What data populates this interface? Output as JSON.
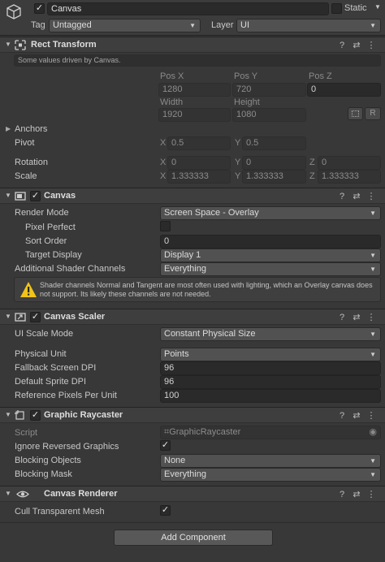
{
  "gameobject": {
    "active_check": "✓",
    "name": "Canvas",
    "static_label": "Static",
    "tag_label": "Tag",
    "tag_value": "Untagged",
    "layer_label": "Layer",
    "layer_value": "UI"
  },
  "rect_transform": {
    "title": "Rect Transform",
    "info": "Some values driven by Canvas.",
    "pos_x_label": "Pos X",
    "pos_y_label": "Pos Y",
    "pos_z_label": "Pos Z",
    "pos_x": "1280",
    "pos_y": "720",
    "pos_z": "0",
    "width_label": "Width",
    "height_label": "Height",
    "width": "1920",
    "height": "1080",
    "r_button": "R",
    "anchors_label": "Anchors",
    "pivot_label": "Pivot",
    "pivot_x_label": "X",
    "pivot_x": "0.5",
    "pivot_y_label": "Y",
    "pivot_y": "0.5",
    "rotation_label": "Rotation",
    "rot_x_label": "X",
    "rot_x": "0",
    "rot_y_label": "Y",
    "rot_y": "0",
    "rot_z_label": "Z",
    "rot_z": "0",
    "scale_label": "Scale",
    "scale_x_label": "X",
    "scale_x": "1.333333",
    "scale_y_label": "Y",
    "scale_y": "1.333333",
    "scale_z_label": "Z",
    "scale_z": "1.333333"
  },
  "canvas": {
    "title": "Canvas",
    "enabled_check": "✓",
    "render_mode_label": "Render Mode",
    "render_mode": "Screen Space - Overlay",
    "pixel_perfect_label": "Pixel Perfect",
    "sort_order_label": "Sort Order",
    "sort_order": "0",
    "target_display_label": "Target Display",
    "target_display": "Display 1",
    "shader_channels_label": "Additional Shader Channels",
    "shader_channels": "Everything",
    "warning": "Shader channels Normal and Tangent are most often used with lighting, which an Overlay canvas does not support. Its likely these channels are not needed."
  },
  "canvas_scaler": {
    "title": "Canvas Scaler",
    "enabled_check": "✓",
    "ui_scale_mode_label": "UI Scale Mode",
    "ui_scale_mode": "Constant Physical Size",
    "physical_unit_label": "Physical Unit",
    "physical_unit": "Points",
    "fallback_dpi_label": "Fallback Screen DPI",
    "fallback_dpi": "96",
    "default_sprite_dpi_label": "Default Sprite DPI",
    "default_sprite_dpi": "96",
    "ref_ppu_label": "Reference Pixels Per Unit",
    "ref_ppu": "100"
  },
  "graphic_raycaster": {
    "title": "Graphic Raycaster",
    "enabled_check": "✓",
    "script_label": "Script",
    "script_value": "GraphicRaycaster",
    "ignore_reversed_label": "Ignore Reversed Graphics",
    "ignore_reversed_check": "✓",
    "blocking_objects_label": "Blocking Objects",
    "blocking_objects": "None",
    "blocking_mask_label": "Blocking Mask",
    "blocking_mask": "Everything"
  },
  "canvas_renderer": {
    "title": "Canvas Renderer",
    "cull_label": "Cull Transparent Mesh",
    "cull_check": "✓"
  },
  "add_component_label": "Add Component",
  "header_tools": {
    "help": "?",
    "presets": "⇄",
    "menu": "⋮"
  },
  "colors": {
    "background": "#383838",
    "header": "#3e3e3e",
    "field": "#2a2a2a",
    "dropdown": "#515151",
    "warning": "#f0c419"
  }
}
